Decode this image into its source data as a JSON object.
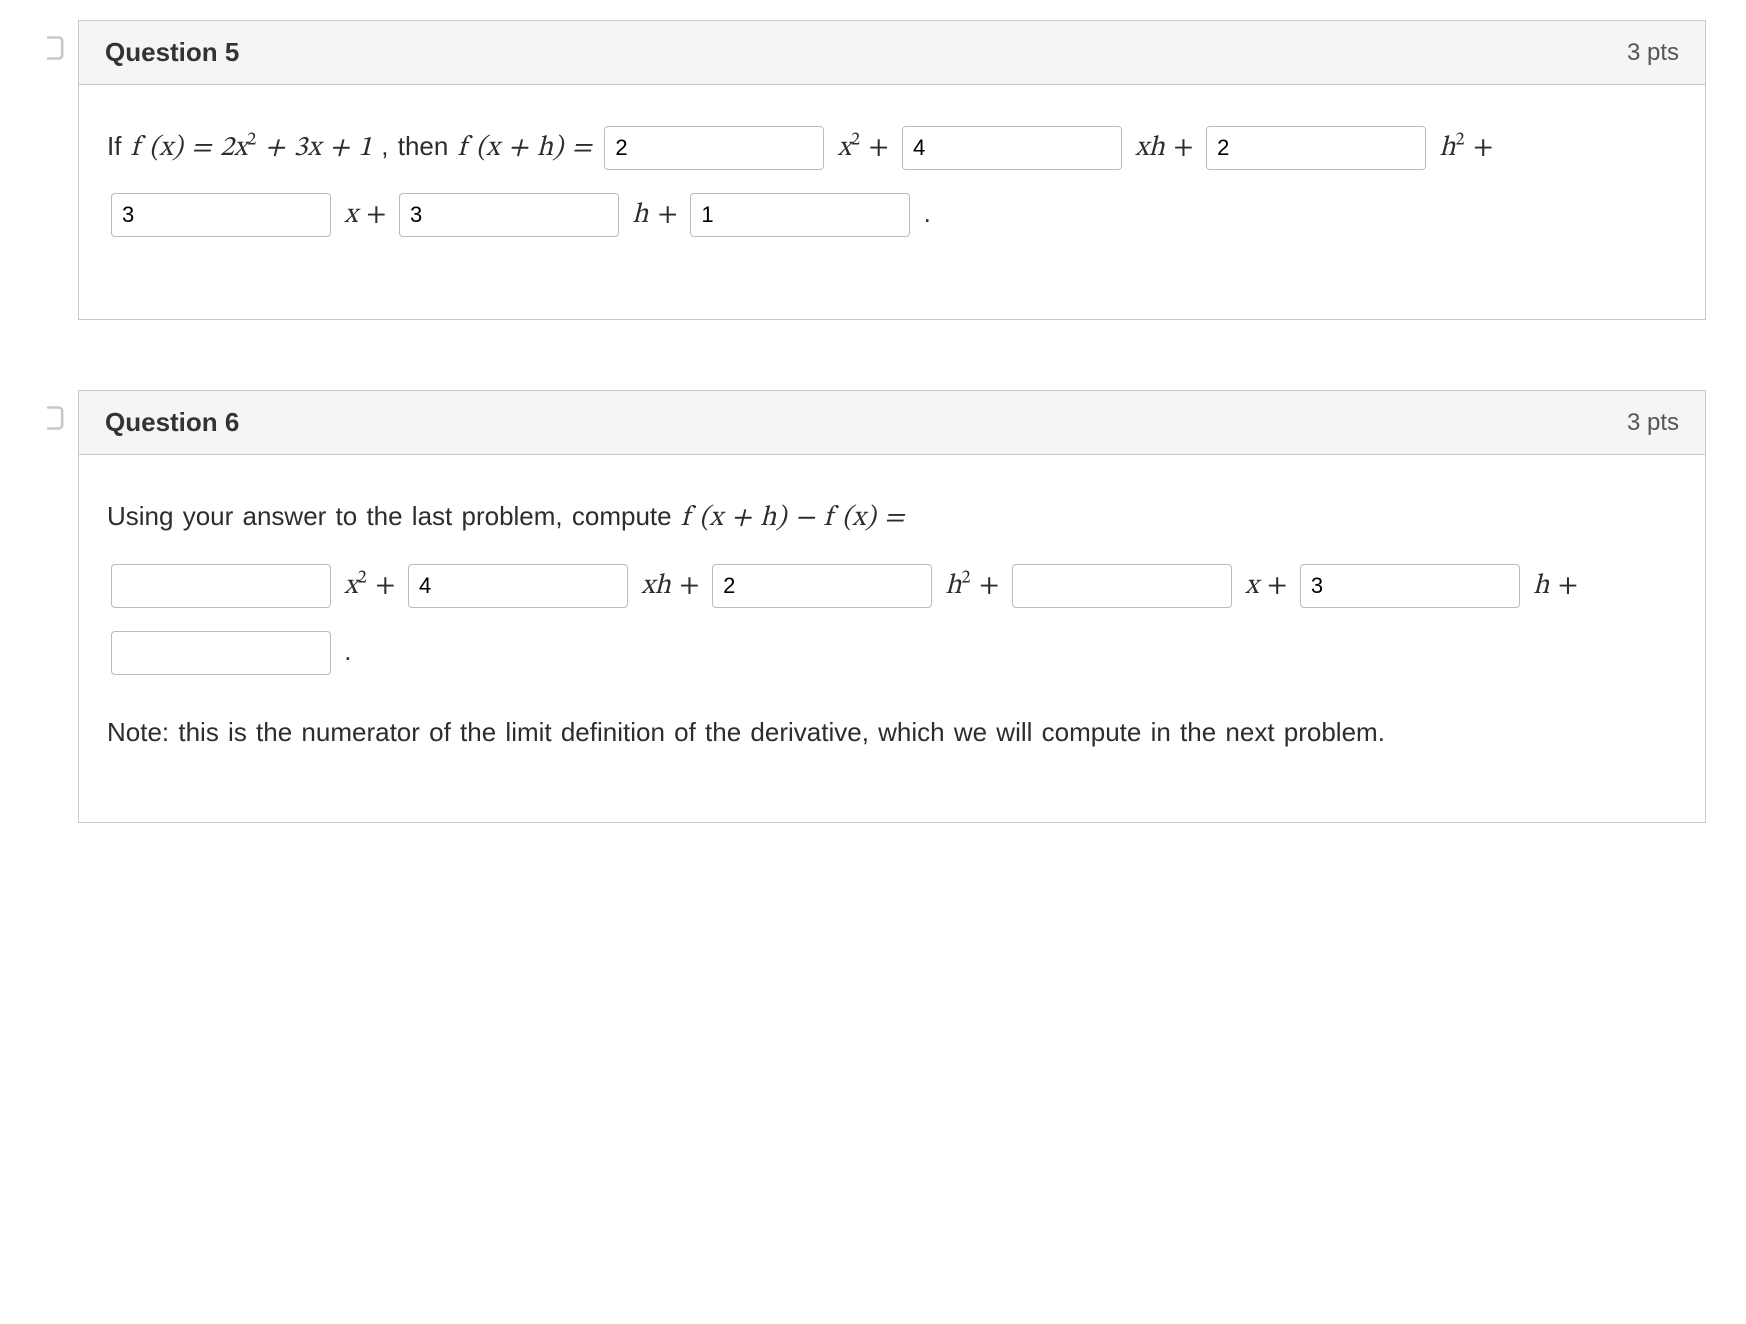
{
  "q5": {
    "title": "Question 5",
    "pts": "3 pts",
    "intro_pre": "If ",
    "intro_fx": "f (x) = 2x",
    "intro_after_sq": " + 3x + 1",
    "intro_then": " , then ",
    "intro_fxh": "f (x + h) = ",
    "b1": "2",
    "t_x2p": "x",
    "t_plus": " +",
    "b2": "4",
    "t_xhp": "xh",
    "b3": "2",
    "t_h2p": "h",
    "b4": "3",
    "t_xp": "x",
    "b5": "3",
    "t_h": "h",
    "b6": "1",
    "t_dot": "."
  },
  "q6": {
    "title": "Question 6",
    "pts": "3 pts",
    "line1": "Using your answer to the last problem, compute ",
    "fxh_fx": "f (x + h) − f (x) =",
    "b1": "",
    "t_x2p": "x",
    "b2": "4",
    "t_xhp": "xh",
    "b3": "2",
    "t_h2p": "h",
    "b4": "",
    "t_xp": "x",
    "b5": "3",
    "t_hp": "h",
    "b6": "",
    "t_dot": ".",
    "note": "Note: this is the numerator of the limit definition of the derivative, which we will compute in the next problem."
  },
  "plus": " + ",
  "sq": "2"
}
